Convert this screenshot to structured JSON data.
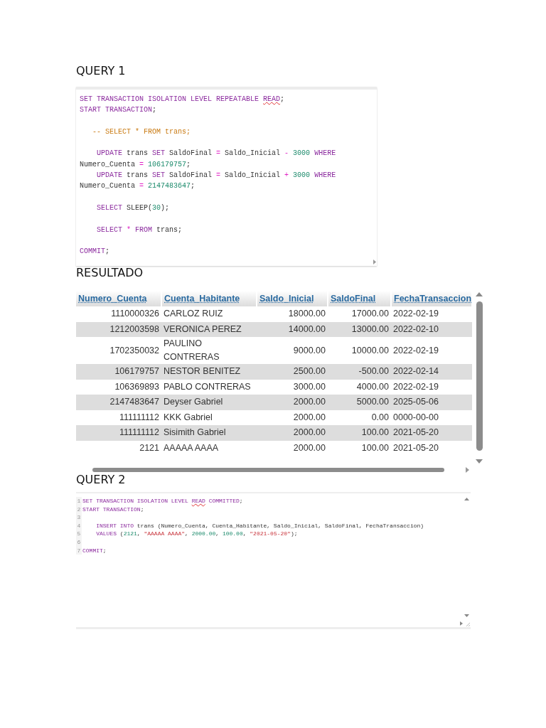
{
  "query_1": {
    "title": "QUERY 1",
    "lines": [
      {
        "kind": "code",
        "tokens": [
          {
            "t": "SET TRANSACTION ISOLATION LEVEL REPEATABLE ",
            "kind": "kw"
          },
          {
            "t": "READ",
            "kind": "kw",
            "misspelled": true
          },
          {
            "t": ";",
            "kind": "plain"
          }
        ]
      },
      {
        "kind": "code",
        "tokens": [
          {
            "t": "START TRANSACTION",
            "kind": "kw"
          },
          {
            "t": ";",
            "kind": "plain"
          }
        ]
      },
      {
        "kind": "blank"
      },
      {
        "kind": "code",
        "tokens": [
          {
            "t": "   -- SELECT * FROM trans;",
            "kind": "cmt"
          }
        ]
      },
      {
        "kind": "blank"
      },
      {
        "kind": "code",
        "tokens": [
          {
            "t": "    UPDATE",
            "kind": "kw"
          },
          {
            "t": " trans ",
            "kind": "plain"
          },
          {
            "t": "SET",
            "kind": "kw"
          },
          {
            "t": " SaldoFinal ",
            "kind": "plain"
          },
          {
            "t": "=",
            "kind": "op"
          },
          {
            "t": " Saldo_Inicial ",
            "kind": "plain"
          },
          {
            "t": "-",
            "kind": "op"
          },
          {
            "t": " 3000",
            "kind": "num"
          },
          {
            "t": " WHERE",
            "kind": "kw"
          }
        ]
      },
      {
        "kind": "code",
        "tokens": [
          {
            "t": "Numero_Cuenta ",
            "kind": "plain"
          },
          {
            "t": "=",
            "kind": "op"
          },
          {
            "t": " 106179757",
            "kind": "num"
          },
          {
            "t": ";",
            "kind": "plain"
          }
        ]
      },
      {
        "kind": "code",
        "tokens": [
          {
            "t": "    UPDATE",
            "kind": "kw"
          },
          {
            "t": " trans ",
            "kind": "plain"
          },
          {
            "t": "SET",
            "kind": "kw"
          },
          {
            "t": " SaldoFinal ",
            "kind": "plain"
          },
          {
            "t": "=",
            "kind": "op"
          },
          {
            "t": " Saldo_Inicial ",
            "kind": "plain"
          },
          {
            "t": "+",
            "kind": "op"
          },
          {
            "t": " 3000",
            "kind": "num"
          },
          {
            "t": " WHERE",
            "kind": "kw"
          }
        ]
      },
      {
        "kind": "code",
        "tokens": [
          {
            "t": "Numero_Cuenta ",
            "kind": "plain"
          },
          {
            "t": "=",
            "kind": "op"
          },
          {
            "t": " 2147483647",
            "kind": "num"
          },
          {
            "t": ";",
            "kind": "plain"
          }
        ]
      },
      {
        "kind": "blank"
      },
      {
        "kind": "code",
        "tokens": [
          {
            "t": "    SELECT",
            "kind": "kw"
          },
          {
            "t": " SLEEP(",
            "kind": "plain"
          },
          {
            "t": "30",
            "kind": "num"
          },
          {
            "t": ");",
            "kind": "plain"
          }
        ]
      },
      {
        "kind": "blank"
      },
      {
        "kind": "code",
        "tokens": [
          {
            "t": "    SELECT",
            "kind": "kw"
          },
          {
            "t": " * ",
            "kind": "op"
          },
          {
            "t": "FROM",
            "kind": "kw"
          },
          {
            "t": " trans;",
            "kind": "plain"
          }
        ]
      },
      {
        "kind": "blank"
      },
      {
        "kind": "code",
        "tokens": [
          {
            "t": "COMMIT",
            "kind": "kw"
          },
          {
            "t": ";",
            "kind": "plain"
          }
        ]
      }
    ]
  },
  "result": {
    "title": "RESULTADO",
    "columns": [
      "Numero_Cuenta",
      "Cuenta_Habitante",
      "Saldo_Inicial",
      "SaldoFinal",
      "FechaTransaccion"
    ],
    "rows": [
      [
        "1110000326",
        "CARLOZ RUIZ",
        "18000.00",
        "17000.00",
        "2022-02-19"
      ],
      [
        "1212003598",
        "VERONICA PEREZ",
        "14000.00",
        "13000.00",
        "2022-02-10"
      ],
      [
        "1702350032",
        "PAULINO CONTRERAS",
        "9000.00",
        "10000.00",
        "2022-02-19"
      ],
      [
        "106179757",
        "NESTOR BENITEZ",
        "2500.00",
        "-500.00",
        "2022-02-14"
      ],
      [
        "106369893",
        "PABLO CONTRERAS",
        "3000.00",
        "4000.00",
        "2022-02-19"
      ],
      [
        "2147483647",
        "Deyser Gabriel",
        "2000.00",
        "5000.00",
        "2025-05-06"
      ],
      [
        "111111112",
        "KKK Gabriel",
        "2000.00",
        "0.00",
        "0000-00-00"
      ],
      [
        "111111112",
        "Sisimith Gabriel",
        "2000.00",
        "100.00",
        "2021-05-20"
      ],
      [
        "2121",
        "AAAAA AAAA",
        "2000.00",
        "100.00",
        "2021-05-20"
      ]
    ]
  },
  "query_2": {
    "title": "QUERY 2",
    "lines": [
      {
        "number": "1",
        "tokens": [
          {
            "t": "SET TRANSACTION ISOLATION LEVEL ",
            "kind": "kw"
          },
          {
            "t": "READ",
            "kind": "kw",
            "misspelled": true
          },
          {
            "t": " COMMITTED",
            "kind": "kw"
          },
          {
            "t": ";",
            "kind": "plain"
          }
        ]
      },
      {
        "number": "2",
        "tokens": [
          {
            "t": "START TRANSACTION",
            "kind": "kw"
          },
          {
            "t": ";",
            "kind": "plain"
          }
        ]
      },
      {
        "number": "3"
      },
      {
        "number": "4",
        "tokens": [
          {
            "t": "    INSERT INTO",
            "kind": "kw"
          },
          {
            "t": " trans ",
            "kind": "plain"
          },
          {
            "t": "(Numero_Cuenta, Cuenta_Habitante, Saldo_Inicial, SaldoFinal, FechaTransaccion)",
            "kind": "plain"
          }
        ]
      },
      {
        "number": "5",
        "tokens": [
          {
            "t": "    VALUES",
            "kind": "kw"
          },
          {
            "t": " (",
            "kind": "plain"
          },
          {
            "t": "2121",
            "kind": "num"
          },
          {
            "t": ", ",
            "kind": "plain"
          },
          {
            "t": "\"AAAAA AAAA\"",
            "kind": "str"
          },
          {
            "t": ", ",
            "kind": "plain"
          },
          {
            "t": "2000.00",
            "kind": "num"
          },
          {
            "t": ", ",
            "kind": "plain"
          },
          {
            "t": "100.00",
            "kind": "num"
          },
          {
            "t": ", ",
            "kind": "plain"
          },
          {
            "t": "\"2021-05-20\"",
            "kind": "str"
          },
          {
            "t": ");",
            "kind": "plain"
          }
        ]
      },
      {
        "number": "6"
      },
      {
        "number": "7",
        "tokens": [
          {
            "t": "COMMIT",
            "kind": "kw"
          },
          {
            "t": ";",
            "kind": "plain"
          }
        ]
      }
    ]
  }
}
